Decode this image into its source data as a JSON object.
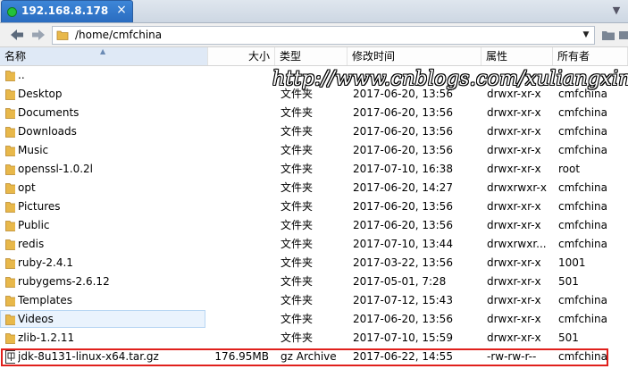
{
  "tab": {
    "title": "192.168.8.178",
    "close_icon": "×"
  },
  "toolbar": {
    "back_icon": "arrow-left-icon",
    "forward_icon": "arrow-right-icon",
    "path": "/home/cmfchina",
    "dropdown_glyph": "▼"
  },
  "columns": {
    "name": "名称",
    "size": "大小",
    "type": "类型",
    "modified": "修改时间",
    "attributes": "属性",
    "owner": "所有者"
  },
  "rows": [
    {
      "name": "..",
      "size": "",
      "type": "",
      "modified": "",
      "attributes": "",
      "owner": "",
      "kind": "folder"
    },
    {
      "name": "Desktop",
      "size": "",
      "type": "文件夹",
      "modified": "2017-06-20, 13:56",
      "attributes": "drwxr-xr-x",
      "owner": "cmfchina",
      "kind": "folder"
    },
    {
      "name": "Documents",
      "size": "",
      "type": "文件夹",
      "modified": "2017-06-20, 13:56",
      "attributes": "drwxr-xr-x",
      "owner": "cmfchina",
      "kind": "folder"
    },
    {
      "name": "Downloads",
      "size": "",
      "type": "文件夹",
      "modified": "2017-06-20, 13:56",
      "attributes": "drwxr-xr-x",
      "owner": "cmfchina",
      "kind": "folder"
    },
    {
      "name": "Music",
      "size": "",
      "type": "文件夹",
      "modified": "2017-06-20, 13:56",
      "attributes": "drwxr-xr-x",
      "owner": "cmfchina",
      "kind": "folder"
    },
    {
      "name": "openssl-1.0.2l",
      "size": "",
      "type": "文件夹",
      "modified": "2017-07-10, 16:38",
      "attributes": "drwxr-xr-x",
      "owner": "root",
      "kind": "folder"
    },
    {
      "name": "opt",
      "size": "",
      "type": "文件夹",
      "modified": "2017-06-20, 14:27",
      "attributes": "drwxrwxr-x",
      "owner": "cmfchina",
      "kind": "folder"
    },
    {
      "name": "Pictures",
      "size": "",
      "type": "文件夹",
      "modified": "2017-06-20, 13:56",
      "attributes": "drwxr-xr-x",
      "owner": "cmfchina",
      "kind": "folder"
    },
    {
      "name": "Public",
      "size": "",
      "type": "文件夹",
      "modified": "2017-06-20, 13:56",
      "attributes": "drwxr-xr-x",
      "owner": "cmfchina",
      "kind": "folder"
    },
    {
      "name": "redis",
      "size": "",
      "type": "文件夹",
      "modified": "2017-07-10, 13:44",
      "attributes": "drwxrwxr...",
      "owner": "cmfchina",
      "kind": "folder"
    },
    {
      "name": "ruby-2.4.1",
      "size": "",
      "type": "文件夹",
      "modified": "2017-03-22, 13:56",
      "attributes": "drwxr-xr-x",
      "owner": "1001",
      "kind": "folder"
    },
    {
      "name": "rubygems-2.6.12",
      "size": "",
      "type": "文件夹",
      "modified": "2017-05-01, 7:28",
      "attributes": "drwxr-xr-x",
      "owner": "501",
      "kind": "folder"
    },
    {
      "name": "Templates",
      "size": "",
      "type": "文件夹",
      "modified": "2017-07-12, 15:43",
      "attributes": "drwxr-xr-x",
      "owner": "cmfchina",
      "kind": "folder"
    },
    {
      "name": "Videos",
      "size": "",
      "type": "文件夹",
      "modified": "2017-06-20, 13:56",
      "attributes": "drwxr-xr-x",
      "owner": "cmfchina",
      "kind": "folder",
      "selected": true
    },
    {
      "name": "zlib-1.2.11",
      "size": "",
      "type": "文件夹",
      "modified": "2017-07-10, 15:59",
      "attributes": "drwxr-xr-x",
      "owner": "501",
      "kind": "folder"
    },
    {
      "name": "jdk-8u131-linux-x64.tar.gz",
      "size": "176.95MB",
      "type": "gz Archive",
      "modified": "2017-06-22, 14:55",
      "attributes": "-rw-rw-r--",
      "owner": "cmfchina",
      "kind": "file"
    }
  ],
  "watermark": "http://www.cnblogs.com/xuliangxing",
  "colors": {
    "tab_active": "#2a6cc0",
    "connected": "#23c23a",
    "highlight": "#e0201c",
    "folder": "#e8b84a"
  }
}
